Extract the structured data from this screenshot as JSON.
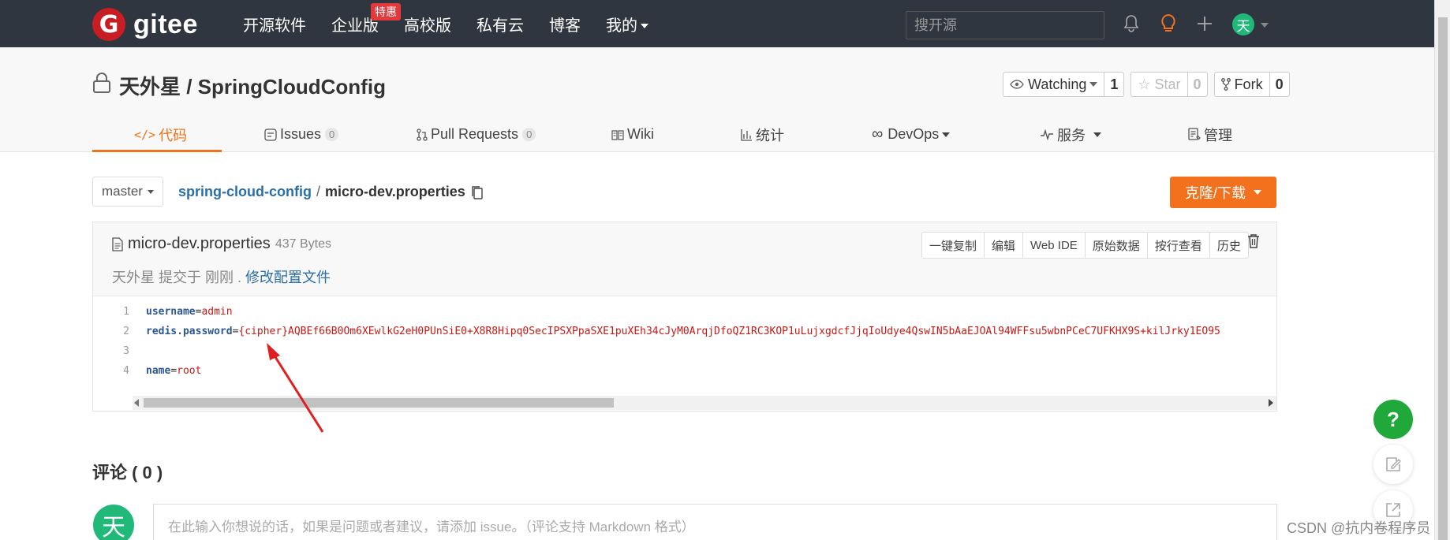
{
  "topbar": {
    "logo_letter": "G",
    "logo_text": "gitee",
    "nav": [
      "开源软件",
      "企业版",
      "高校版",
      "私有云",
      "博客",
      "我的"
    ],
    "hot_badge": "特惠",
    "search_placeholder": "搜开源",
    "avatar_char": "天"
  },
  "repo": {
    "title": "天外星 / SpringCloudConfig",
    "watching_label": "Watching",
    "watching_count": "1",
    "star_label": "Star",
    "star_count": "0",
    "fork_label": "Fork",
    "fork_count": "0"
  },
  "tabs": {
    "code": "代码",
    "issues": "Issues",
    "issues_count": "0",
    "pulls": "Pull Requests",
    "pulls_count": "0",
    "wiki": "Wiki",
    "stats": "统计",
    "devops": "DevOps",
    "services": "服务",
    "manage": "管理"
  },
  "path": {
    "branch": "master",
    "repo": "spring-cloud-config",
    "sep": "/",
    "file": "micro-dev.properties",
    "clone_label": "克隆/下载"
  },
  "file": {
    "name": "micro-dev.properties",
    "size": "437 Bytes",
    "commit_author": "天外星 提交于 刚刚 .",
    "commit_message": "修改配置文件",
    "actions": [
      "一键复制",
      "编辑",
      "Web IDE",
      "原始数据",
      "按行查看",
      "历史"
    ]
  },
  "code_lines": [
    {
      "num": "1",
      "key": "username",
      "eq": "=",
      "value": "admin"
    },
    {
      "num": "2",
      "key": "redis.password",
      "eq": "=",
      "value": "{cipher}AQBEf66B0Om6XEwlkG2eH0PUnSiE0+X8R8Hipq0SecIPSXPpaSXE1puXEh34cJyM0ArqjDfoQZ1RC3KOP1uLujxgdcfJjqIoUdye4QswIN5bAaEJOAl94WFFsu5wbnPCeC7UFKHX9S+kilJrky1EO95"
    },
    {
      "num": "3",
      "key": "",
      "eq": "",
      "value": ""
    },
    {
      "num": "4",
      "key": "name",
      "eq": "=",
      "value": "root"
    }
  ],
  "comments": {
    "title": "评论 ( 0 )",
    "avatar_char": "天",
    "placeholder": "在此输入你想说的话，如果是问题或者建议，请添加 issue。（评论支持 Markdown 格式）"
  },
  "floating": {
    "help": "?"
  },
  "watermark": "CSDN @抗内卷程序员",
  "colors": {
    "topbar": "#2f3640",
    "accent": "#f0731d",
    "link": "#2a6fa8",
    "brand_red": "#c71d23",
    "avatar": "#21b97a"
  }
}
